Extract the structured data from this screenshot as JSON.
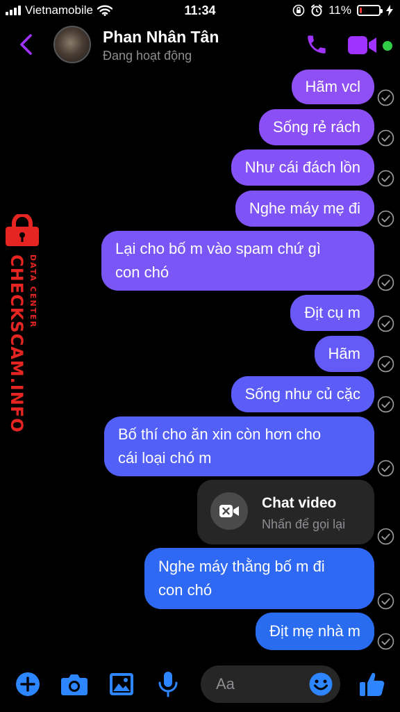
{
  "status_bar": {
    "carrier": "Vietnamobile",
    "time": "11:34",
    "battery_percent": "11%",
    "battery_level": 0.11,
    "icons": [
      "signal-icon",
      "wifi-icon",
      "orientation-lock-icon",
      "alarm-icon",
      "battery-icon",
      "charging-icon"
    ]
  },
  "header": {
    "contact_name": "Phan Nhân Tân",
    "contact_status": "Đang hoạt động",
    "icons": [
      "back-chevron-icon",
      "phone-icon",
      "video-camera-icon"
    ]
  },
  "messages": [
    {
      "text": "Hãm vcl",
      "color": "#8e4ff3"
    },
    {
      "text": "Sống rẻ rách",
      "color": "#8a4ff5"
    },
    {
      "text": "Như cái đách lồn",
      "color": "#8452f6"
    },
    {
      "text": "Nghe máy mẹ đi",
      "color": "#7e54f6"
    },
    {
      "text": "Lại cho bố m vào spam chứ gì\ncon chó",
      "color": "#7a56f7"
    },
    {
      "text": "Địt cụ m",
      "color": "#6a58f7"
    },
    {
      "text": "Hãm",
      "color": "#645af7"
    },
    {
      "text": "Sống như củ cặc",
      "color": "#5c5cf8"
    },
    {
      "text": "Bố thí cho ăn xin còn hơn cho\ncái loại chó m",
      "color": "#5360f8"
    },
    {
      "text": "Nghe máy thằng bố m đi\ncon chó",
      "color": "#2f68f2"
    },
    {
      "text": "Địt mẹ nhà m",
      "color": "#2a6cf0"
    }
  ],
  "video_call": {
    "title": "Chat video",
    "subtitle": "Nhấn để gọi lại",
    "icon": "missed-video-call-icon"
  },
  "watermark": {
    "main": "CHECKSCAM.INFO",
    "sub": "DATA CENTER",
    "color": "#e52521"
  },
  "composer": {
    "placeholder": "Aa",
    "icons": [
      "plus-icon",
      "camera-icon",
      "gallery-icon",
      "microphone-icon",
      "emoji-icon",
      "thumbs-up-icon"
    ],
    "accent": "#2d86ff"
  },
  "colors": {
    "header_accent": "#a033ff",
    "online": "#31cc46",
    "background": "#000000"
  }
}
